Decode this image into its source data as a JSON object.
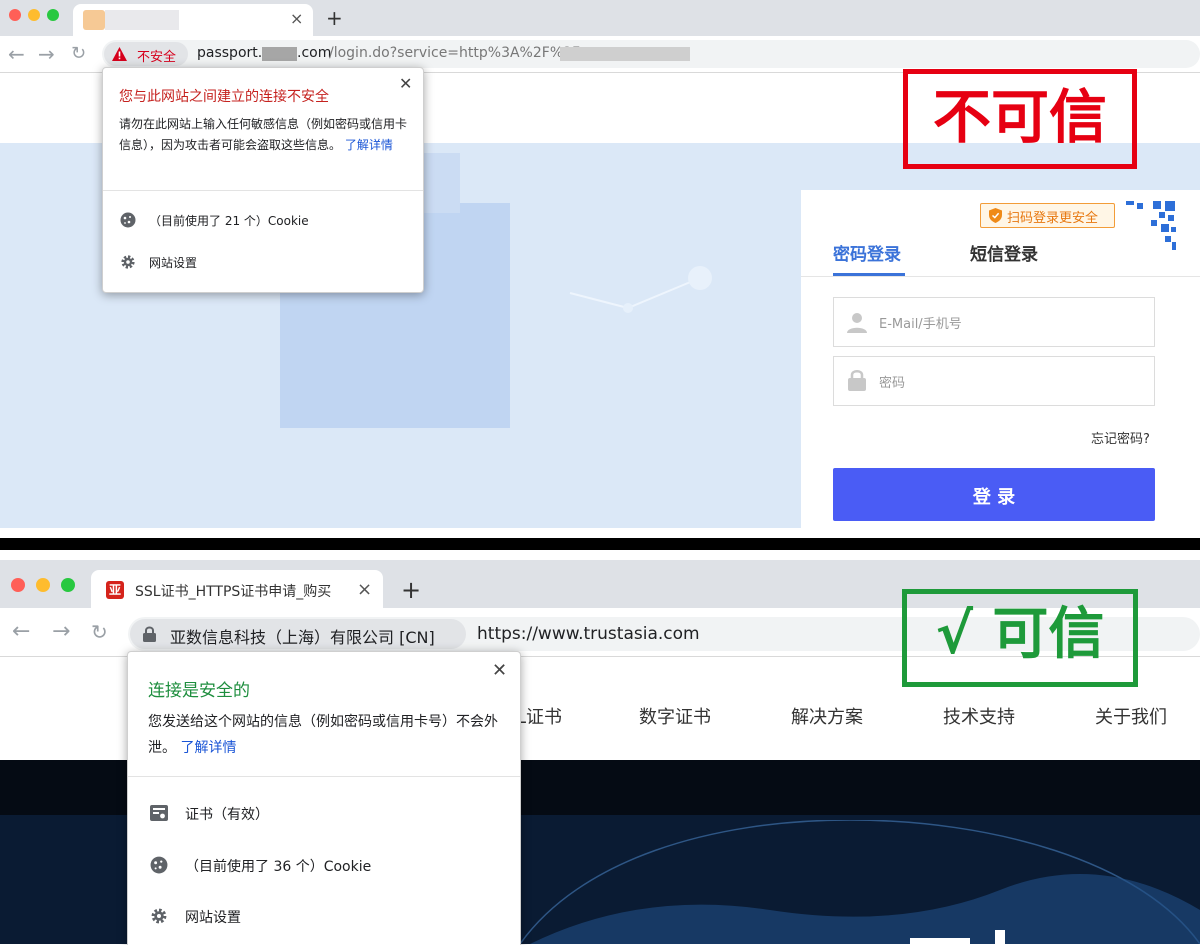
{
  "top": {
    "tab": {
      "close": "×",
      "new_tab": "+"
    },
    "security_chip": "不安全",
    "url": {
      "host_start": "passport.",
      "host_end": ".com",
      "path": "/login.do?service=http%3A%2F%2F"
    },
    "popup": {
      "title": "您与此网站之间建立的连接不安全",
      "desc": "请勿在此网站上输入任何敏感信息（例如密码或信用卡信息），因为攻击者可能会盗取这些信息。",
      "link": "了解详情",
      "cookie": "（目前使用了 21 个）Cookie",
      "settings": "网站设置"
    },
    "stamp": "不可信",
    "login": {
      "qr_tip": "扫码登录更安全",
      "tab_password": "密码登录",
      "tab_sms": "短信登录",
      "email_placeholder": "E-Mail/手机号",
      "password_placeholder": "密码",
      "forgot": "忘记密码?",
      "submit": "登 录"
    }
  },
  "bottom": {
    "tab": {
      "title": "SSL证书_HTTPS证书申请_购买",
      "close": "×",
      "new_tab": "+"
    },
    "org_chip": "亚数信息科技（上海）有限公司 [CN]",
    "url": "https://www.trustasia.com",
    "popup": {
      "title": "连接是安全的",
      "desc": "您发送给这个网站的信息（例如密码或信用卡号）不会外泄。",
      "link": "了解详情",
      "cert": "证书（有效）",
      "cookie": "（目前使用了 36 个）Cookie",
      "settings": "网站设置"
    },
    "stamp": "√ 可信",
    "nav": [
      "L证书",
      "数字证书",
      "解决方案",
      "技术支持",
      "关于我们"
    ]
  },
  "colors": {
    "unsafe_red": "#d6001c",
    "safe_green": "#1e9a3a",
    "link_blue": "#1a55d6",
    "login_blue": "#4a5cf5",
    "tab_active_blue": "#3b73d9"
  }
}
